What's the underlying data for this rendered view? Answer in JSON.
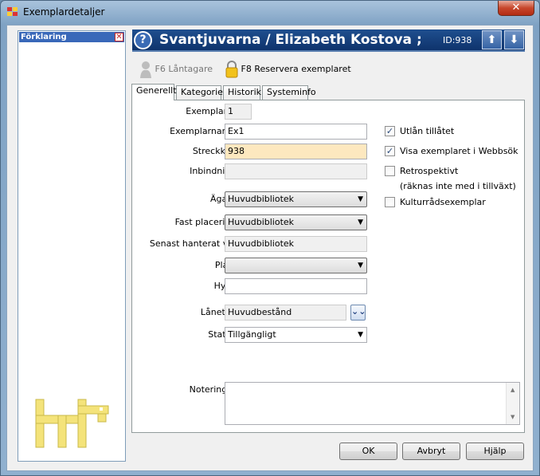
{
  "window": {
    "title": "Exemplardetaljer",
    "close_glyph": "✕"
  },
  "sidebar": {
    "title": "Förklaring",
    "close_glyph": "✕"
  },
  "header": {
    "help_glyph": "?",
    "title": "Svantjuvarna / Elizabeth Kostova ;",
    "id_label": "ID:938",
    "up_glyph": "⬆",
    "down_glyph": "⬇",
    "bg_color": "#163f7c"
  },
  "toolbar": {
    "borrower_label": "F6 Låntagare",
    "reserve_label": "F8 Reservera exemplaret"
  },
  "tabs": [
    "Generellt",
    "Kategorier",
    "Historik",
    "Systeminfo"
  ],
  "form": {
    "exemplarnr": {
      "label": "Exemplarnr:",
      "value": "1"
    },
    "exemplarnamn": {
      "label": "Exemplarnamn:",
      "value": "Ex1"
    },
    "streckkod": {
      "label": "Streckkod:",
      "value": "938"
    },
    "inbindning": {
      "label": "Inbindning:",
      "value": ""
    },
    "agare": {
      "label": "Ägare:",
      "value": "Huvudbibliotek"
    },
    "fast_placering": {
      "label": "Fast placering:",
      "value": "Huvudbibliotek"
    },
    "senast": {
      "label": "Senast hanterat vid:",
      "value": "Huvudbibliotek"
    },
    "plats": {
      "label": "Plats:",
      "value": ""
    },
    "hylla": {
      "label": "Hylla:",
      "value": ""
    },
    "lanetyp": {
      "label": "Lånetyp:",
      "value": "Huvudbestånd",
      "expand_glyph": "⌄⌄"
    },
    "status": {
      "label": "Status:",
      "value": "Tillgängligt"
    },
    "noteringar": {
      "label": "Noteringar:",
      "value": ""
    }
  },
  "checkboxes": {
    "utlan": {
      "label": "Utlån tillåtet",
      "checked": true
    },
    "webbsok": {
      "label": "Visa exemplaret i Webbsök",
      "checked": true
    },
    "retro": {
      "label": "Retrospektivt",
      "checked": false
    },
    "retro_note": "(räknas inte med i tillväxt)",
    "kultur": {
      "label": "Kulturrådsexemplar",
      "checked": false
    }
  },
  "check_glyph": "✓",
  "dropdown_glyph": "▼",
  "buttons": {
    "ok": "OK",
    "cancel": "Avbryt",
    "help": "Hjälp"
  },
  "colors": {
    "accent": "#3968b9",
    "highlight_field": "#fde8bf"
  }
}
